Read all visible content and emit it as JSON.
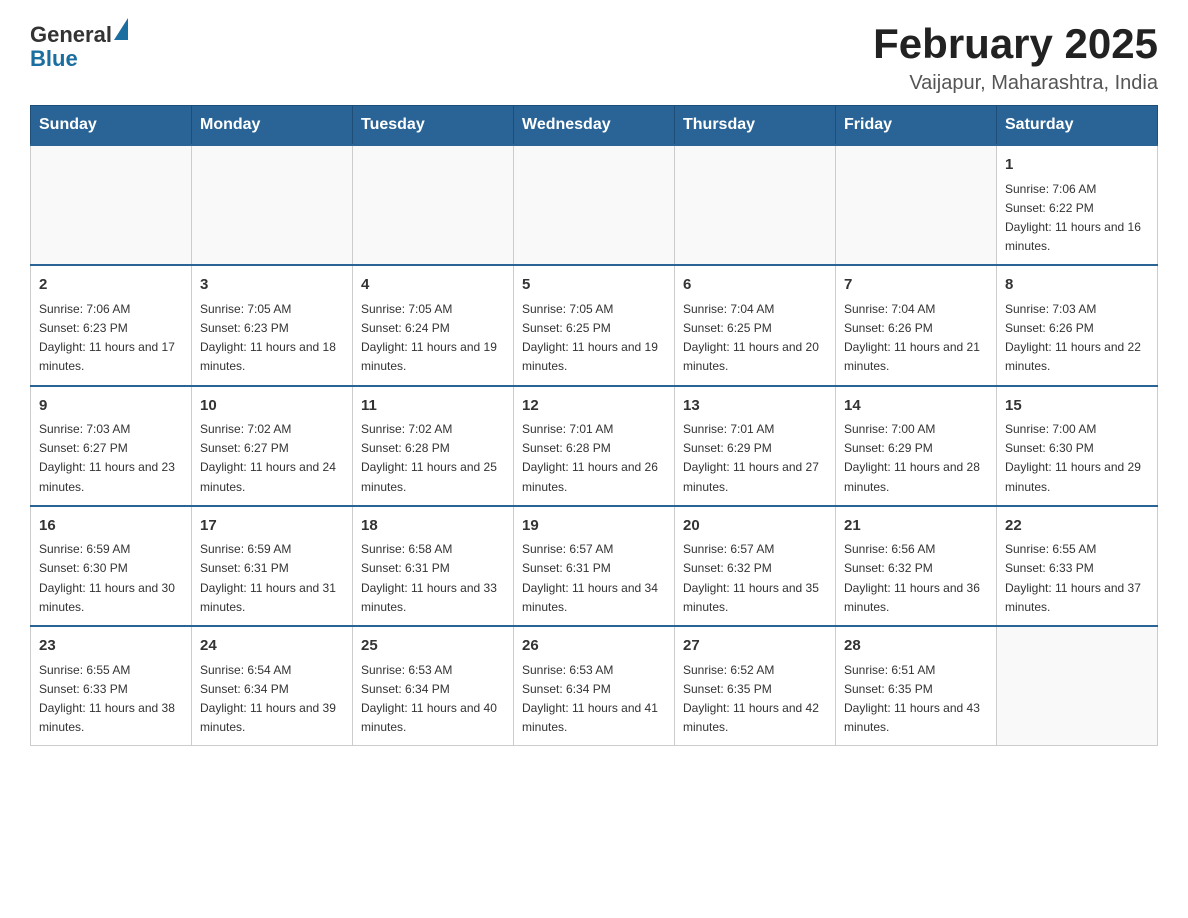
{
  "header": {
    "logo": {
      "general": "General",
      "blue": "Blue"
    },
    "title": "February 2025",
    "subtitle": "Vaijapur, Maharashtra, India"
  },
  "weekdays": [
    "Sunday",
    "Monday",
    "Tuesday",
    "Wednesday",
    "Thursday",
    "Friday",
    "Saturday"
  ],
  "weeks": [
    [
      {
        "day": "",
        "info": ""
      },
      {
        "day": "",
        "info": ""
      },
      {
        "day": "",
        "info": ""
      },
      {
        "day": "",
        "info": ""
      },
      {
        "day": "",
        "info": ""
      },
      {
        "day": "",
        "info": ""
      },
      {
        "day": "1",
        "info": "Sunrise: 7:06 AM\nSunset: 6:22 PM\nDaylight: 11 hours and 16 minutes."
      }
    ],
    [
      {
        "day": "2",
        "info": "Sunrise: 7:06 AM\nSunset: 6:23 PM\nDaylight: 11 hours and 17 minutes."
      },
      {
        "day": "3",
        "info": "Sunrise: 7:05 AM\nSunset: 6:23 PM\nDaylight: 11 hours and 18 minutes."
      },
      {
        "day": "4",
        "info": "Sunrise: 7:05 AM\nSunset: 6:24 PM\nDaylight: 11 hours and 19 minutes."
      },
      {
        "day": "5",
        "info": "Sunrise: 7:05 AM\nSunset: 6:25 PM\nDaylight: 11 hours and 19 minutes."
      },
      {
        "day": "6",
        "info": "Sunrise: 7:04 AM\nSunset: 6:25 PM\nDaylight: 11 hours and 20 minutes."
      },
      {
        "day": "7",
        "info": "Sunrise: 7:04 AM\nSunset: 6:26 PM\nDaylight: 11 hours and 21 minutes."
      },
      {
        "day": "8",
        "info": "Sunrise: 7:03 AM\nSunset: 6:26 PM\nDaylight: 11 hours and 22 minutes."
      }
    ],
    [
      {
        "day": "9",
        "info": "Sunrise: 7:03 AM\nSunset: 6:27 PM\nDaylight: 11 hours and 23 minutes."
      },
      {
        "day": "10",
        "info": "Sunrise: 7:02 AM\nSunset: 6:27 PM\nDaylight: 11 hours and 24 minutes."
      },
      {
        "day": "11",
        "info": "Sunrise: 7:02 AM\nSunset: 6:28 PM\nDaylight: 11 hours and 25 minutes."
      },
      {
        "day": "12",
        "info": "Sunrise: 7:01 AM\nSunset: 6:28 PM\nDaylight: 11 hours and 26 minutes."
      },
      {
        "day": "13",
        "info": "Sunrise: 7:01 AM\nSunset: 6:29 PM\nDaylight: 11 hours and 27 minutes."
      },
      {
        "day": "14",
        "info": "Sunrise: 7:00 AM\nSunset: 6:29 PM\nDaylight: 11 hours and 28 minutes."
      },
      {
        "day": "15",
        "info": "Sunrise: 7:00 AM\nSunset: 6:30 PM\nDaylight: 11 hours and 29 minutes."
      }
    ],
    [
      {
        "day": "16",
        "info": "Sunrise: 6:59 AM\nSunset: 6:30 PM\nDaylight: 11 hours and 30 minutes."
      },
      {
        "day": "17",
        "info": "Sunrise: 6:59 AM\nSunset: 6:31 PM\nDaylight: 11 hours and 31 minutes."
      },
      {
        "day": "18",
        "info": "Sunrise: 6:58 AM\nSunset: 6:31 PM\nDaylight: 11 hours and 33 minutes."
      },
      {
        "day": "19",
        "info": "Sunrise: 6:57 AM\nSunset: 6:31 PM\nDaylight: 11 hours and 34 minutes."
      },
      {
        "day": "20",
        "info": "Sunrise: 6:57 AM\nSunset: 6:32 PM\nDaylight: 11 hours and 35 minutes."
      },
      {
        "day": "21",
        "info": "Sunrise: 6:56 AM\nSunset: 6:32 PM\nDaylight: 11 hours and 36 minutes."
      },
      {
        "day": "22",
        "info": "Sunrise: 6:55 AM\nSunset: 6:33 PM\nDaylight: 11 hours and 37 minutes."
      }
    ],
    [
      {
        "day": "23",
        "info": "Sunrise: 6:55 AM\nSunset: 6:33 PM\nDaylight: 11 hours and 38 minutes."
      },
      {
        "day": "24",
        "info": "Sunrise: 6:54 AM\nSunset: 6:34 PM\nDaylight: 11 hours and 39 minutes."
      },
      {
        "day": "25",
        "info": "Sunrise: 6:53 AM\nSunset: 6:34 PM\nDaylight: 11 hours and 40 minutes."
      },
      {
        "day": "26",
        "info": "Sunrise: 6:53 AM\nSunset: 6:34 PM\nDaylight: 11 hours and 41 minutes."
      },
      {
        "day": "27",
        "info": "Sunrise: 6:52 AM\nSunset: 6:35 PM\nDaylight: 11 hours and 42 minutes."
      },
      {
        "day": "28",
        "info": "Sunrise: 6:51 AM\nSunset: 6:35 PM\nDaylight: 11 hours and 43 minutes."
      },
      {
        "day": "",
        "info": ""
      }
    ]
  ]
}
